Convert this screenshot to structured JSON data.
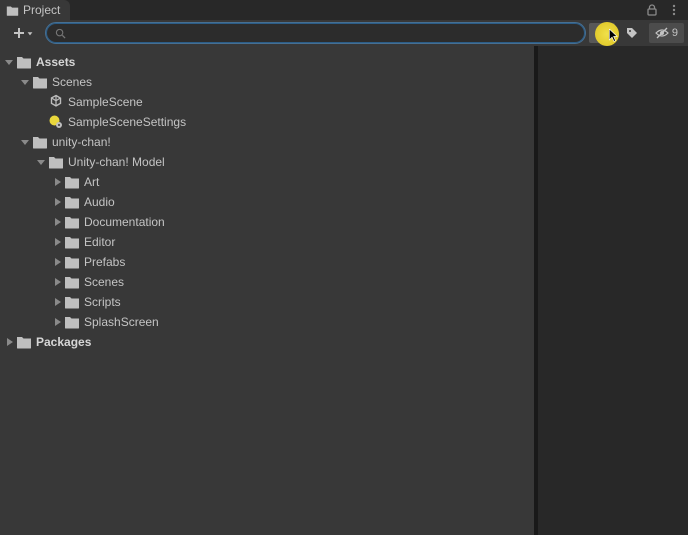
{
  "tab": {
    "title": "Project"
  },
  "toolbar": {
    "hidden_count": "9"
  },
  "tree": {
    "assets": {
      "label": "Assets"
    },
    "scenes": {
      "label": "Scenes"
    },
    "samplescene": {
      "label": "SampleScene"
    },
    "samplescenesettings": {
      "label": "SampleSceneSettings"
    },
    "unitychan": {
      "label": "unity-chan!"
    },
    "unitychanmodel": {
      "label": "Unity-chan! Model"
    },
    "art": {
      "label": "Art"
    },
    "audio": {
      "label": "Audio"
    },
    "documentation": {
      "label": "Documentation"
    },
    "editor": {
      "label": "Editor"
    },
    "prefabs": {
      "label": "Prefabs"
    },
    "scenes2": {
      "label": "Scenes"
    },
    "scripts": {
      "label": "Scripts"
    },
    "splashscreen": {
      "label": "SplashScreen"
    },
    "packages": {
      "label": "Packages"
    }
  }
}
